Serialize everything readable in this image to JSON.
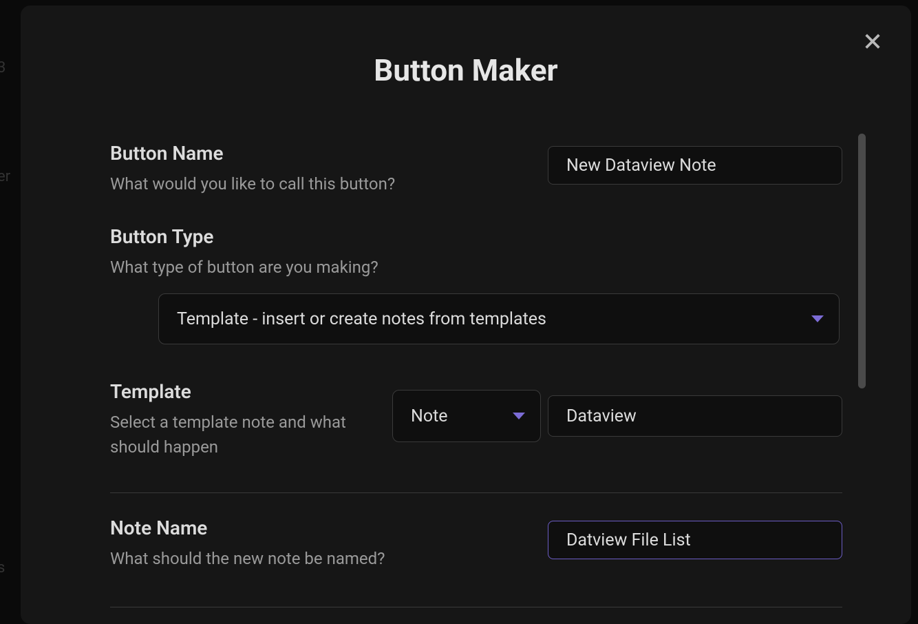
{
  "modal": {
    "title": "Button Maker"
  },
  "fields": {
    "buttonName": {
      "label": "Button Name",
      "desc": "What would you like to call this button?",
      "value": "New Dataview Note"
    },
    "buttonType": {
      "label": "Button Type",
      "desc": "What type of button are you making?",
      "selected": "Template - insert or create notes from templates"
    },
    "template": {
      "label": "Template",
      "desc": "Select a template note and what should happen",
      "actionSelected": "Note",
      "templateValue": "Dataview"
    },
    "noteName": {
      "label": "Note Name",
      "desc": "What should the new note be named?",
      "value": "Datview File List"
    }
  },
  "bgFragments": {
    "a": "3",
    "b": "er",
    "c": "s"
  }
}
